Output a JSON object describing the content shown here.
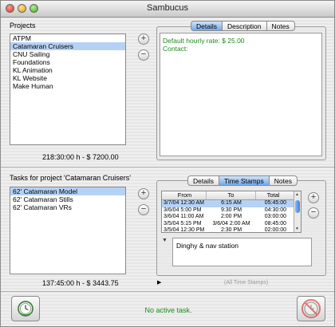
{
  "window": {
    "title": "Sambucus"
  },
  "projects": {
    "label": "Projects",
    "items": [
      {
        "name": "ATPM",
        "selected": false
      },
      {
        "name": "Catamaran Cruisers",
        "selected": true
      },
      {
        "name": "CNU Sailing",
        "selected": false
      },
      {
        "name": "Foundations",
        "selected": false
      },
      {
        "name": "KL Animation",
        "selected": false
      },
      {
        "name": "KL Website",
        "selected": false
      },
      {
        "name": "Make Human",
        "selected": false
      }
    ],
    "add_label": "+",
    "remove_label": "−",
    "summary": "218:30:00 h - $ 7200.00",
    "tabs": [
      "Details",
      "Description",
      "Notes"
    ],
    "active_tab": "Details",
    "details": {
      "hourly_rate": "Default hourly rate: $ 25.00",
      "contact": "Contact:"
    }
  },
  "tasks": {
    "label": "Tasks for project 'Catamaran Cruisers'",
    "items": [
      {
        "name": "62' Catamaran Model",
        "selected": true
      },
      {
        "name": "62' Catamaran Stills",
        "selected": false
      },
      {
        "name": "62' Catamaran VRs",
        "selected": false
      }
    ],
    "add_label": "+",
    "remove_label": "−",
    "summary": "137:45:00 h - $ 3443.75",
    "disclosure": "▶",
    "all_time_stamps": "(All Time Stamps)",
    "tabs": [
      "Details",
      "Time Stamps",
      "Notes"
    ],
    "active_tab": "Time Stamps",
    "timestamps": {
      "columns": [
        "From",
        "To",
        "Total"
      ],
      "rows": [
        {
          "from": "3/7/04 12:30 AM",
          "to": "6:15 AM",
          "total": "05:45:00",
          "selected": true
        },
        {
          "from": "3/6/04 5:00 PM",
          "to": "9:30 PM",
          "total": "04:30:00",
          "selected": false
        },
        {
          "from": "3/6/04 11:00 AM",
          "to": "2:00 PM",
          "total": "03:00:00",
          "selected": false
        },
        {
          "from": "3/5/04 5:15 PM",
          "to": "3/6/04 2:00 AM",
          "total": "08:45:00",
          "selected": false
        },
        {
          "from": "3/5/04 12:30 PM",
          "to": "2:30 PM",
          "total": "02:00:00",
          "selected": false
        }
      ],
      "note": "Dinghy & nav station",
      "note_disclosure": "▼"
    }
  },
  "status": {
    "text": "No active task.",
    "color": "#1f8a1f"
  },
  "icons": {
    "start": "clock-start-icon",
    "stop": "stop-no-icon"
  }
}
